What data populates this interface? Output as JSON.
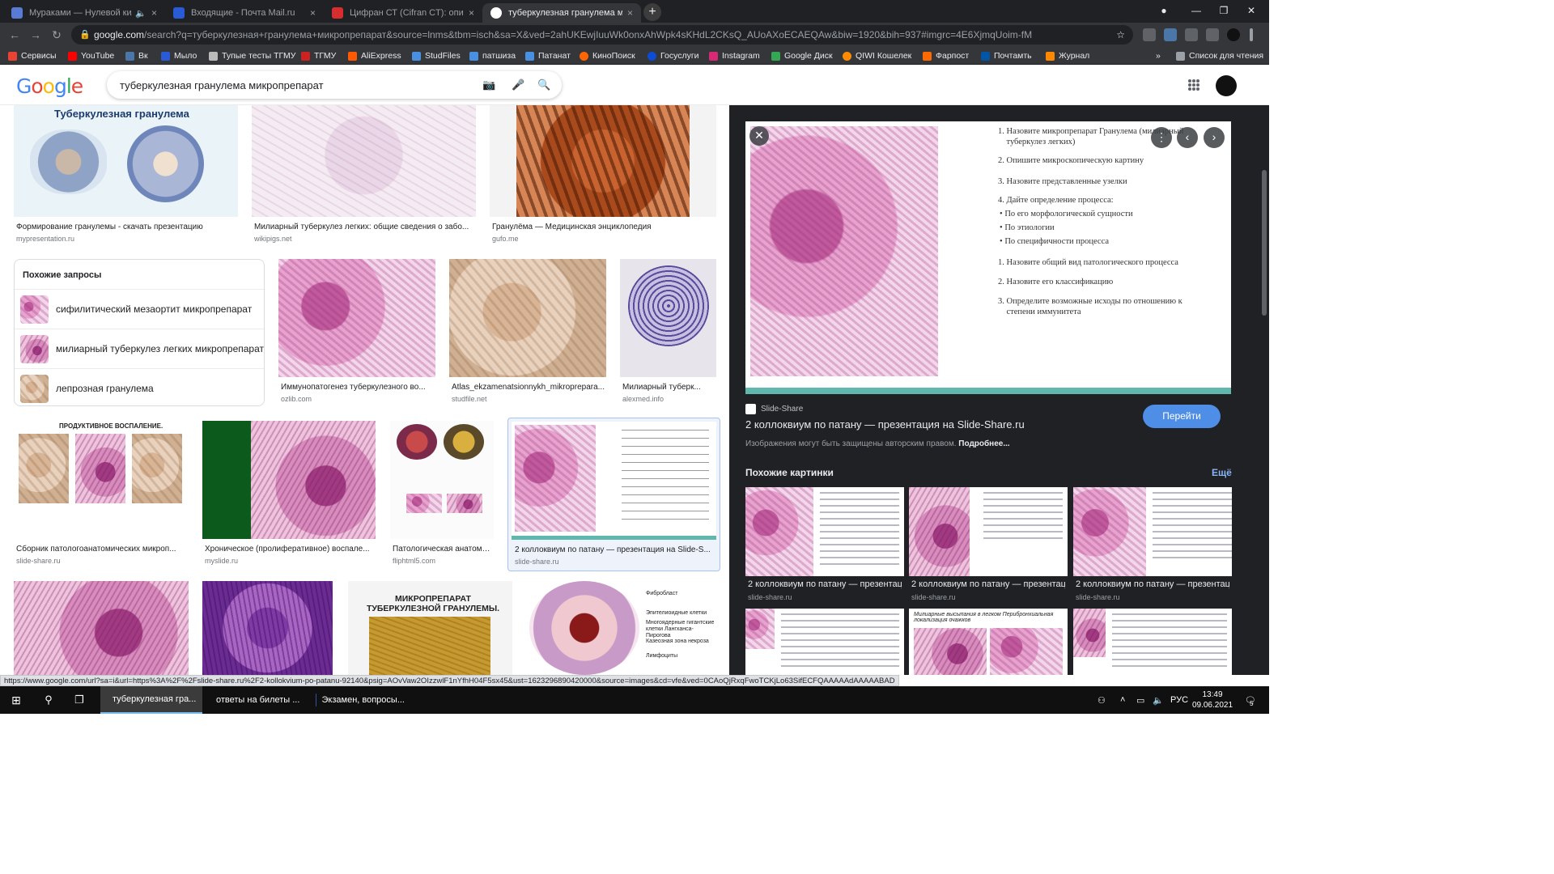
{
  "tabs": [
    {
      "title": "Мураками — Нулевой кило",
      "close": "×",
      "color": "#5a7bd5"
    },
    {
      "title": "Входящие - Почта Mail.ru",
      "close": "×",
      "color": "#2a5bd7"
    },
    {
      "title": "Цифран СТ (Cifran CT): описание",
      "close": "×",
      "color": "#d62e2e"
    },
    {
      "title": "туберкулезная гранулема микр",
      "close": "×",
      "color": "#ffffff"
    }
  ],
  "new_tab": "+",
  "window_controls": {
    "minimize": "—",
    "maximize": "❐",
    "close": "✕"
  },
  "nav": {
    "back": "←",
    "forward": "→",
    "reload": "↻"
  },
  "address": {
    "host": "google.com",
    "path": "/search?q=туберкулезная+гранулема+микропрепарат&source=lnms&tbm=isch&sa=X&ved=2ahUKEwjIuuWk0onxAhWpk4sKHdL2CKsQ_AUoAXoECAEQAw&biw=1920&bih=937#imgrc=4E6XjmqUoim-fM",
    "star": "☆"
  },
  "bookmarks": [
    {
      "label": "Сервисы",
      "color": "#ea4335"
    },
    {
      "label": "YouTube",
      "color": "#ff0000"
    },
    {
      "label": "Вк",
      "color": "#4a76a8"
    },
    {
      "label": "Мыло",
      "color": "#2a5bd7"
    },
    {
      "label": "Тупые тесты ТГМУ",
      "color": "#bbbbbb"
    },
    {
      "label": "ТГМУ",
      "color": "#cc2222"
    },
    {
      "label": "AliExpress",
      "color": "#ff5a00"
    },
    {
      "label": "StudFiles",
      "color": "#4a90e2"
    },
    {
      "label": "патшиза",
      "color": "#4a90e2"
    },
    {
      "label": "Патанат",
      "color": "#4a90e2"
    },
    {
      "label": "КиноПоиск",
      "color": "#ff6600"
    },
    {
      "label": "Госуслуги",
      "color": "#0d4cd3"
    },
    {
      "label": "Instagram",
      "color": "#d62976"
    },
    {
      "label": "Google Диск",
      "color": "#34a853"
    },
    {
      "label": "QIWI Кошелек",
      "color": "#ff8c00"
    },
    {
      "label": "Фарпост",
      "color": "#ff6a00"
    },
    {
      "label": "Почтамть",
      "color": "#0055a5"
    },
    {
      "label": "Журнал",
      "color": "#ff8800"
    }
  ],
  "bookmarks_more": "»",
  "reading_list": "Список для чтения",
  "search": {
    "query": "туберкулезная гранулема микропрепарат",
    "camera": "📷",
    "mic": "🎤",
    "magnifier": "🔍"
  },
  "logo": "Google",
  "grid": {
    "row1": [
      {
        "caption": "Формирование гранулемы - скачать презентацию",
        "source": "mypresentation.ru",
        "title_overlay": "Туберкулезная гранулема"
      },
      {
        "caption": "Милиарный туберкулез легких: общие сведения о забо...",
        "source": "wikipigs.net"
      },
      {
        "caption": "Гранулёма — Медицинская энциклопедия",
        "source": "gufo.me"
      }
    ],
    "related": {
      "title": "Похожие запросы",
      "items": [
        "сифилитический мезаортит микропрепарат",
        "милиарный туберкулез легких микропрепарат",
        "лепрозная гранулема"
      ]
    },
    "row2": [
      {
        "caption": "Иммунопатогенез туберкулезного во...",
        "source": "ozlib.com"
      },
      {
        "caption": "Atlas_ekzamenatsionnykh_mikroprepara...",
        "source": "studfile.net"
      },
      {
        "caption": "Милиарный туберк...",
        "source": "alexmed.info"
      }
    ],
    "row3": [
      {
        "caption": "Сборник патологоанатомических микроп...",
        "source": "slide-share.ru",
        "title_overlay": "ПРОДУКТИВНОЕ ВОСПАЛЕНИЕ."
      },
      {
        "caption": "Хроническое (пролиферативное) воспале...",
        "source": "myslide.ru"
      },
      {
        "caption": "Патологическая анатоми...",
        "source": "fliphtml5.com"
      },
      {
        "caption": "2 коллоквиум по патану — презентация на Slide-S...",
        "source": "slide-share.ru"
      }
    ],
    "row4": [
      {
        "caption": ""
      },
      {
        "caption": ""
      },
      {
        "caption": "",
        "title_overlay": "МИКРОПРЕПАРАТ ТУБЕРКУЛЕЗНОЙ ГРАНУЛЕМЫ."
      },
      {
        "caption": "",
        "labels": [
          "Фибробласт",
          "Эпителиоидные клетки",
          "Многоядерные гигантские клетки Лангханса-Пирогова",
          "Казеозная зона некроза",
          "Лимфоциты"
        ]
      }
    ]
  },
  "panel": {
    "close": "✕",
    "more": "⋮",
    "prev": "‹",
    "next": "›",
    "slide_lines": [
      {
        "num": "1.",
        "text": "Назовите микропрепарат Гранулема (милиарный туберкулез легких)"
      },
      {
        "num": "2.",
        "text": "Опишите микроскопическую картину"
      },
      {
        "num": "3.",
        "text": "Назовите  представленные узелки"
      },
      {
        "num": "4.",
        "text": "Дайте определение процесса:"
      },
      {
        "num": "•",
        "text": "По его морфологической сущности"
      },
      {
        "num": "•",
        "text": "По этиологии"
      },
      {
        "num": "•",
        "text": "По специфичности процесса"
      },
      {
        "num": "1.",
        "text": "Назовите общий вид  патологического процесса"
      },
      {
        "num": "2.",
        "text": "Назовите его классификацию"
      },
      {
        "num": "3.",
        "text": "Определите возможные исходы  по отношению к степени иммунитета"
      }
    ],
    "source": "Slide-Share",
    "title": "2 коллоквиум по патану — презентация на Slide-Share.ru",
    "go": "Перейти",
    "copyright": "Изображения могут быть защищены авторским правом.",
    "more_link": "Подробнее...",
    "similar_title": "Похожие картинки",
    "similar_more": "Ещё",
    "similar": [
      {
        "caption": "2 коллоквиум по патану — презентац...",
        "source": "slide-share.ru"
      },
      {
        "caption": "2 коллоквиум по патану — презентац...",
        "source": "slide-share.ru"
      },
      {
        "caption": "2 коллоквиум по патану — презентац...",
        "source": "slide-share.ru"
      },
      {
        "caption": ""
      },
      {
        "caption": "",
        "overlay": "Милиарные высыпания в легком    Перибронхиальная локализация очажков"
      },
      {
        "caption": ""
      }
    ]
  },
  "status_url": "https://www.google.com/url?sa=i&url=https%3A%2F%2Fslide-share.ru%2F2-kollokvium-po-patanu-92140&psig=AOvVaw2OIzzwlF1nYfhH04F5sx45&ust=1623296890420000&source=images&cd=vfe&ved=0CAoQjRxqFwoTCKjLo63SifECFQAAAAAdAAAAABAD",
  "taskbar": {
    "apps": [
      {
        "label": "туберкулезная гра...",
        "color": "#db4437"
      },
      {
        "label": "ответы на билеты ...",
        "color": "#2b579a"
      },
      {
        "label": "Экзамен, вопросы...",
        "color": "#2b579a"
      }
    ],
    "lang": "РУС",
    "time": "13:49",
    "date": "09.06.2021",
    "notif": "5"
  }
}
